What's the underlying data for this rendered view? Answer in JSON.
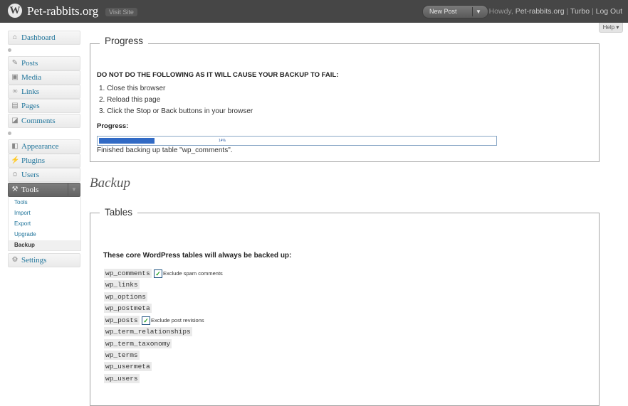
{
  "header": {
    "site_title": "Pet-rabbits.org",
    "visit_site": "Visit Site",
    "new_post": "New Post",
    "howdy": "Howdy,",
    "user": "Pet-rabbits.org",
    "separator": "|",
    "turbo": "Turbo",
    "log_out": "Log Out"
  },
  "help": "Help",
  "sidebar": {
    "items": [
      {
        "label": "Dashboard",
        "icon": "dashboard-icon"
      },
      {
        "label": "Posts",
        "icon": "pushpin-icon"
      },
      {
        "label": "Media",
        "icon": "media-icon"
      },
      {
        "label": "Links",
        "icon": "link-icon"
      },
      {
        "label": "Pages",
        "icon": "pages-icon"
      },
      {
        "label": "Comments",
        "icon": "comments-icon"
      },
      {
        "label": "Appearance",
        "icon": "appearance-icon"
      },
      {
        "label": "Plugins",
        "icon": "plugins-icon"
      },
      {
        "label": "Users",
        "icon": "users-icon"
      },
      {
        "label": "Tools",
        "icon": "tools-icon"
      },
      {
        "label": "Settings",
        "icon": "settings-icon"
      }
    ],
    "tools_submenu": [
      "Tools",
      "Import",
      "Export",
      "Upgrade",
      "Backup"
    ]
  },
  "progress": {
    "title": "Progress",
    "warning": "DO NOT DO THE FOLLOWING AS IT WILL CAUSE YOUR BACKUP TO FAIL:",
    "steps": [
      "1.  Close this browser",
      "2.  Reload this page",
      "3.  Click the Stop or Back buttons in your browser"
    ],
    "progress_label": "Progress:",
    "percent_text": "14%",
    "fraction": 0.14,
    "status": "Finished backing up table \"wp_comments\".",
    "bar_color": "#316ac5"
  },
  "backup_title": "Backup",
  "tables": {
    "title": "Tables",
    "intro": "These core WordPress tables will always be backed up:",
    "rows": [
      {
        "name": "wp_comments",
        "option": "Exclude spam comments",
        "checked": true
      },
      {
        "name": "wp_links"
      },
      {
        "name": "wp_options"
      },
      {
        "name": "wp_postmeta"
      },
      {
        "name": "wp_posts",
        "option": "Exclude post revisions",
        "checked": true
      },
      {
        "name": "wp_term_relationships"
      },
      {
        "name": "wp_term_taxonomy"
      },
      {
        "name": "wp_terms"
      },
      {
        "name": "wp_usermeta"
      },
      {
        "name": "wp_users"
      }
    ]
  },
  "colors": {
    "header_bg": "#464646",
    "link": "#21759b",
    "accent_check": "#21a121"
  }
}
